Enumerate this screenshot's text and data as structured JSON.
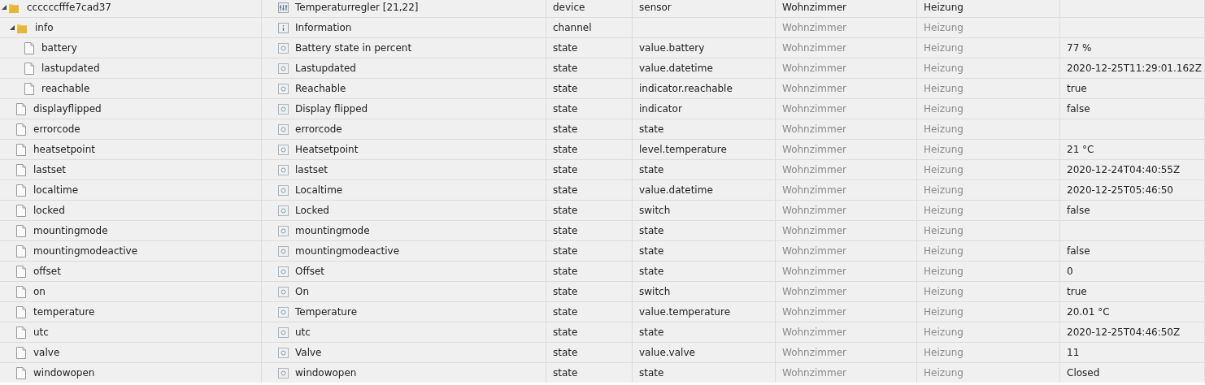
{
  "tree": [
    {
      "name": "ccccccfffe7cad37",
      "kind": "folder",
      "expanded": true,
      "title": "Temperaturregler [21,22]",
      "type": "device",
      "role": "sensor",
      "room": "Wohnzimmer",
      "function": "Heizung",
      "inherited": false,
      "children": [
        {
          "name": "info",
          "kind": "folder",
          "expanded": true,
          "title": "Information",
          "type": "channel",
          "room": "Wohnzimmer",
          "function": "Heizung",
          "inherited": true,
          "children": [
            {
              "name": "battery",
              "kind": "file",
              "title": "Battery state in percent",
              "type": "state",
              "role": "value.battery",
              "room": "Wohnzimmer",
              "function": "Heizung",
              "value": "77 %",
              "inherited": true
            },
            {
              "name": "lastupdated",
              "kind": "file",
              "title": "Lastupdated",
              "type": "state",
              "role": "value.datetime",
              "room": "Wohnzimmer",
              "function": "Heizung",
              "value": "2020-12-25T11:29:01.162Z",
              "inherited": true
            },
            {
              "name": "reachable",
              "kind": "file",
              "title": "Reachable",
              "type": "state",
              "role": "indicator.reachable",
              "room": "Wohnzimmer",
              "function": "Heizung",
              "value": "true",
              "inherited": true
            }
          ]
        },
        {
          "name": "displayflipped",
          "kind": "file",
          "title": "Display flipped",
          "type": "state",
          "role": "indicator",
          "room": "Wohnzimmer",
          "function": "Heizung",
          "value": "false",
          "inherited": true
        },
        {
          "name": "errorcode",
          "kind": "file",
          "title": "errorcode",
          "type": "state",
          "role": "state",
          "room": "Wohnzimmer",
          "function": "Heizung",
          "inherited": true
        },
        {
          "name": "heatsetpoint",
          "kind": "file",
          "title": "Heatsetpoint",
          "type": "state",
          "role": "level.temperature",
          "room": "Wohnzimmer",
          "function": "Heizung",
          "value": "21 °C",
          "inherited": true
        },
        {
          "name": "lastset",
          "kind": "file",
          "title": "lastset",
          "type": "state",
          "role": "state",
          "room": "Wohnzimmer",
          "function": "Heizung",
          "value": "2020-12-24T04:40:55Z",
          "inherited": true
        },
        {
          "name": "localtime",
          "kind": "file",
          "title": "Localtime",
          "type": "state",
          "role": "value.datetime",
          "room": "Wohnzimmer",
          "function": "Heizung",
          "value": "2020-12-25T05:46:50",
          "inherited": true
        },
        {
          "name": "locked",
          "kind": "file",
          "title": "Locked",
          "type": "state",
          "role": "switch",
          "room": "Wohnzimmer",
          "function": "Heizung",
          "value": "false",
          "inherited": true
        },
        {
          "name": "mountingmode",
          "kind": "file",
          "title": "mountingmode",
          "type": "state",
          "role": "state",
          "room": "Wohnzimmer",
          "function": "Heizung",
          "inherited": true
        },
        {
          "name": "mountingmodeactive",
          "kind": "file",
          "title": "mountingmodeactive",
          "type": "state",
          "role": "state",
          "room": "Wohnzimmer",
          "function": "Heizung",
          "value": "false",
          "inherited": true
        },
        {
          "name": "offset",
          "kind": "file",
          "title": "Offset",
          "type": "state",
          "role": "state",
          "room": "Wohnzimmer",
          "function": "Heizung",
          "value": "0",
          "inherited": true
        },
        {
          "name": "on",
          "kind": "file",
          "title": "On",
          "type": "state",
          "role": "switch",
          "room": "Wohnzimmer",
          "function": "Heizung",
          "value": "true",
          "inherited": true
        },
        {
          "name": "temperature",
          "kind": "file",
          "title": "Temperature",
          "type": "state",
          "role": "value.temperature",
          "room": "Wohnzimmer",
          "function": "Heizung",
          "value": "20.01 °C",
          "inherited": true
        },
        {
          "name": "utc",
          "kind": "file",
          "title": "utc",
          "type": "state",
          "role": "state",
          "room": "Wohnzimmer",
          "function": "Heizung",
          "value": "2020-12-25T04:46:50Z",
          "inherited": true
        },
        {
          "name": "valve",
          "kind": "file",
          "title": "Valve",
          "type": "state",
          "role": "value.valve",
          "room": "Wohnzimmer",
          "function": "Heizung",
          "value": "11",
          "inherited": true
        },
        {
          "name": "windowopen",
          "kind": "file",
          "title": "windowopen",
          "type": "state",
          "role": "state",
          "room": "Wohnzimmer",
          "function": "Heizung",
          "value": "Closed",
          "inherited": true
        }
      ]
    }
  ]
}
